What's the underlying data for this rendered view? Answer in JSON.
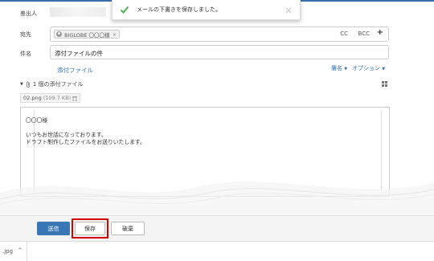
{
  "toast": {
    "message": "メールの下書きを保存しました。",
    "close": "×"
  },
  "form": {
    "sender_label": "差出人",
    "to_label": "宛先",
    "to_chip": "BIGLOBE 〇〇〇様",
    "to_chip_remove": "×",
    "cc": "CC",
    "bcc": "BCC",
    "add": "+",
    "subject_label": "件名",
    "subject_value": "添付ファイルの件",
    "attach_link": "添付ファイル",
    "signature_menu": "署名",
    "options_menu": "オプション"
  },
  "attachments": {
    "header": "1 個の添付ファイル",
    "file_name": "02.png",
    "file_size": "(109.7 KB)"
  },
  "body": {
    "line1": "〇〇〇様",
    "line2": "いつもお世話になっております。",
    "line3": "ドラフト制作したファイルをお送りいたします。"
  },
  "buttons": {
    "send": "送信",
    "save": "保存",
    "discard": "破棄"
  },
  "taskbar": {
    "file": ".jpg",
    "chevron": "^"
  },
  "colors": {
    "accent": "#2f74b5",
    "send_bg": "#3876b5",
    "highlight": "#d50000"
  }
}
